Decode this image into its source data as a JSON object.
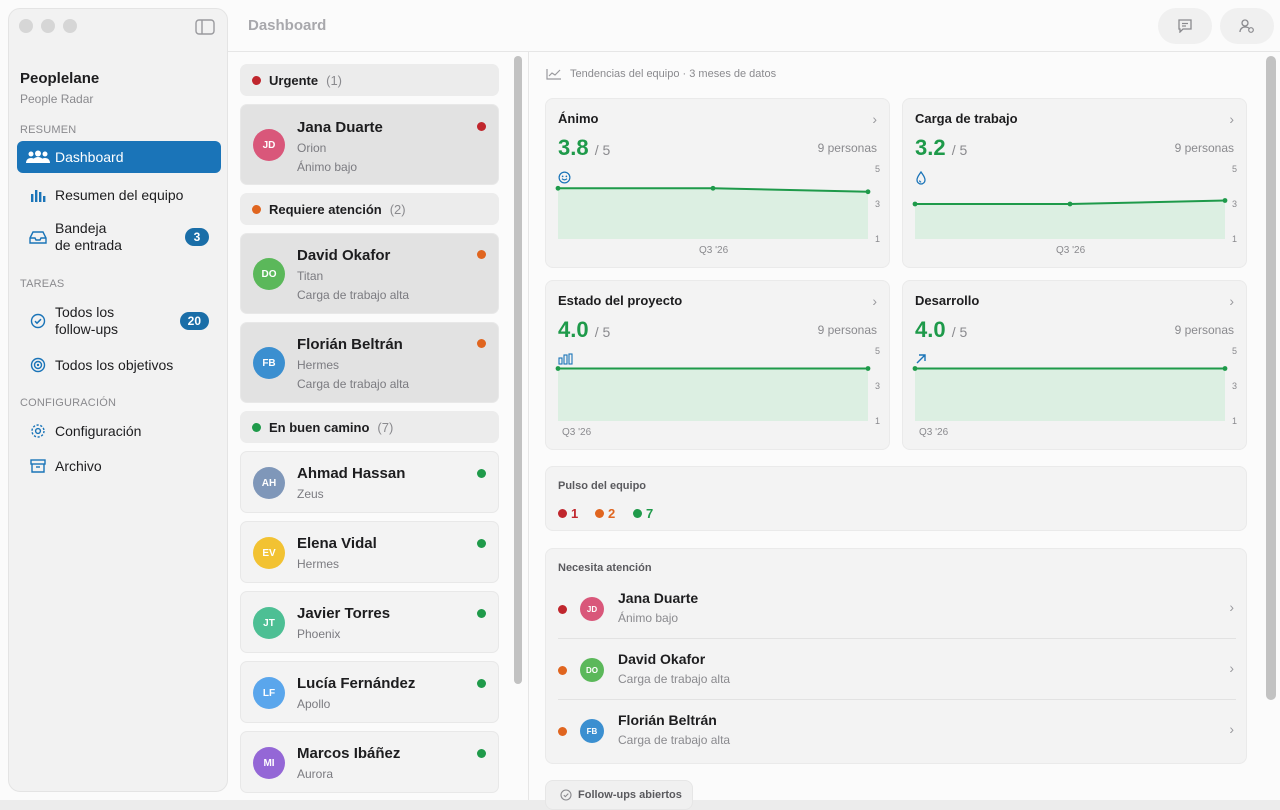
{
  "sidebar": {
    "app_name": "Peoplelane",
    "app_sub": "People Radar",
    "sections": {
      "resumen": "RESUMEN",
      "tareas": "TAREAS",
      "config": "CONFIGURACIÓN"
    },
    "items": [
      {
        "label": "Dashboard"
      },
      {
        "label": "Resumen del equipo"
      },
      {
        "label": "Bandeja\nde entrada",
        "badge": "3"
      },
      {
        "label": "Todos los\nfollow-ups",
        "badge": "20"
      },
      {
        "label": "Todos los objetivos"
      },
      {
        "label": "Configuración"
      },
      {
        "label": "Archivo"
      }
    ]
  },
  "toolbar": {
    "title": "Dashboard"
  },
  "groups": [
    {
      "label": "Urgente",
      "count": "(1)",
      "color": "#c0262d"
    },
    {
      "label": "Requiere atención",
      "count": "(2)",
      "color": "#e0651f"
    },
    {
      "label": "En buen camino",
      "count": "(7)",
      "color": "#1f9a4a"
    }
  ],
  "people": [
    {
      "initials": "JD",
      "name": "Jana Duarte",
      "project": "Orion",
      "note": "Ánimo bajo",
      "color": "#d9577a",
      "status": "#c0262d"
    },
    {
      "initials": "DO",
      "name": "David Okafor",
      "project": "Titan",
      "note": "Carga de trabajo alta",
      "color": "#5bb85a",
      "status": "#e0651f"
    },
    {
      "initials": "FB",
      "name": "Florián Beltrán",
      "project": "Hermes",
      "note": "Carga de trabajo alta",
      "color": "#3b8fd0",
      "status": "#e0651f"
    },
    {
      "initials": "AH",
      "name": "Ahmad Hassan",
      "project": "Zeus",
      "note": "",
      "color": "#7f97b9",
      "status": "#1f9a4a"
    },
    {
      "initials": "EV",
      "name": "Elena Vidal",
      "project": "Hermes",
      "note": "",
      "color": "#f2c232",
      "status": "#1f9a4a"
    },
    {
      "initials": "JT",
      "name": "Javier Torres",
      "project": "Phoenix",
      "note": "",
      "color": "#4dbf94",
      "status": "#1f9a4a"
    },
    {
      "initials": "LF",
      "name": "Lucía Fernández",
      "project": "Apollo",
      "note": "",
      "color": "#5aa6ec",
      "status": "#1f9a4a"
    },
    {
      "initials": "MI",
      "name": "Marcos Ibáñez",
      "project": "Aurora",
      "note": "",
      "color": "#9467d6",
      "status": "#1f9a4a"
    }
  ],
  "trends": {
    "heading": "Tendencias del equipo · 3 meses de datos",
    "of_label": "/ 5",
    "metrics": [
      {
        "title": "Ánimo",
        "value": "3.8",
        "people": "9 personas",
        "x_label": "Q3 '26",
        "points": [
          3.9,
          3.9,
          3.7
        ]
      },
      {
        "title": "Carga de trabajo",
        "value": "3.2",
        "people": "9 personas",
        "x_label": "Q3 '26",
        "points": [
          3.0,
          3.0,
          3.2
        ]
      },
      {
        "title": "Estado del proyecto",
        "value": "4.0",
        "people": "9 personas",
        "x_label": "Q3 '26",
        "points": [
          4.0,
          4.0
        ]
      },
      {
        "title": "Desarrollo",
        "value": "4.0",
        "people": "9 personas",
        "x_label": "Q3 '26",
        "points": [
          4.0,
          4.0
        ]
      }
    ],
    "y_ticks": [
      "5",
      "3",
      "1"
    ]
  },
  "pulse": {
    "title": "Pulso del equipo",
    "red": "1",
    "orange": "2",
    "green": "7"
  },
  "attention": {
    "title": "Necesita atención",
    "rows": [
      {
        "initials": "JD",
        "name": "Jana Duarte",
        "note": "Ánimo bajo",
        "color": "#d9577a",
        "status": "#c0262d"
      },
      {
        "initials": "DO",
        "name": "David Okafor",
        "note": "Carga de trabajo alta",
        "color": "#5bb85a",
        "status": "#e0651f"
      },
      {
        "initials": "FB",
        "name": "Florián Beltrán",
        "note": "Carga de trabajo alta",
        "color": "#3b8fd0",
        "status": "#e0651f"
      }
    ]
  },
  "followups": {
    "label": "Follow-ups abiertos"
  }
}
